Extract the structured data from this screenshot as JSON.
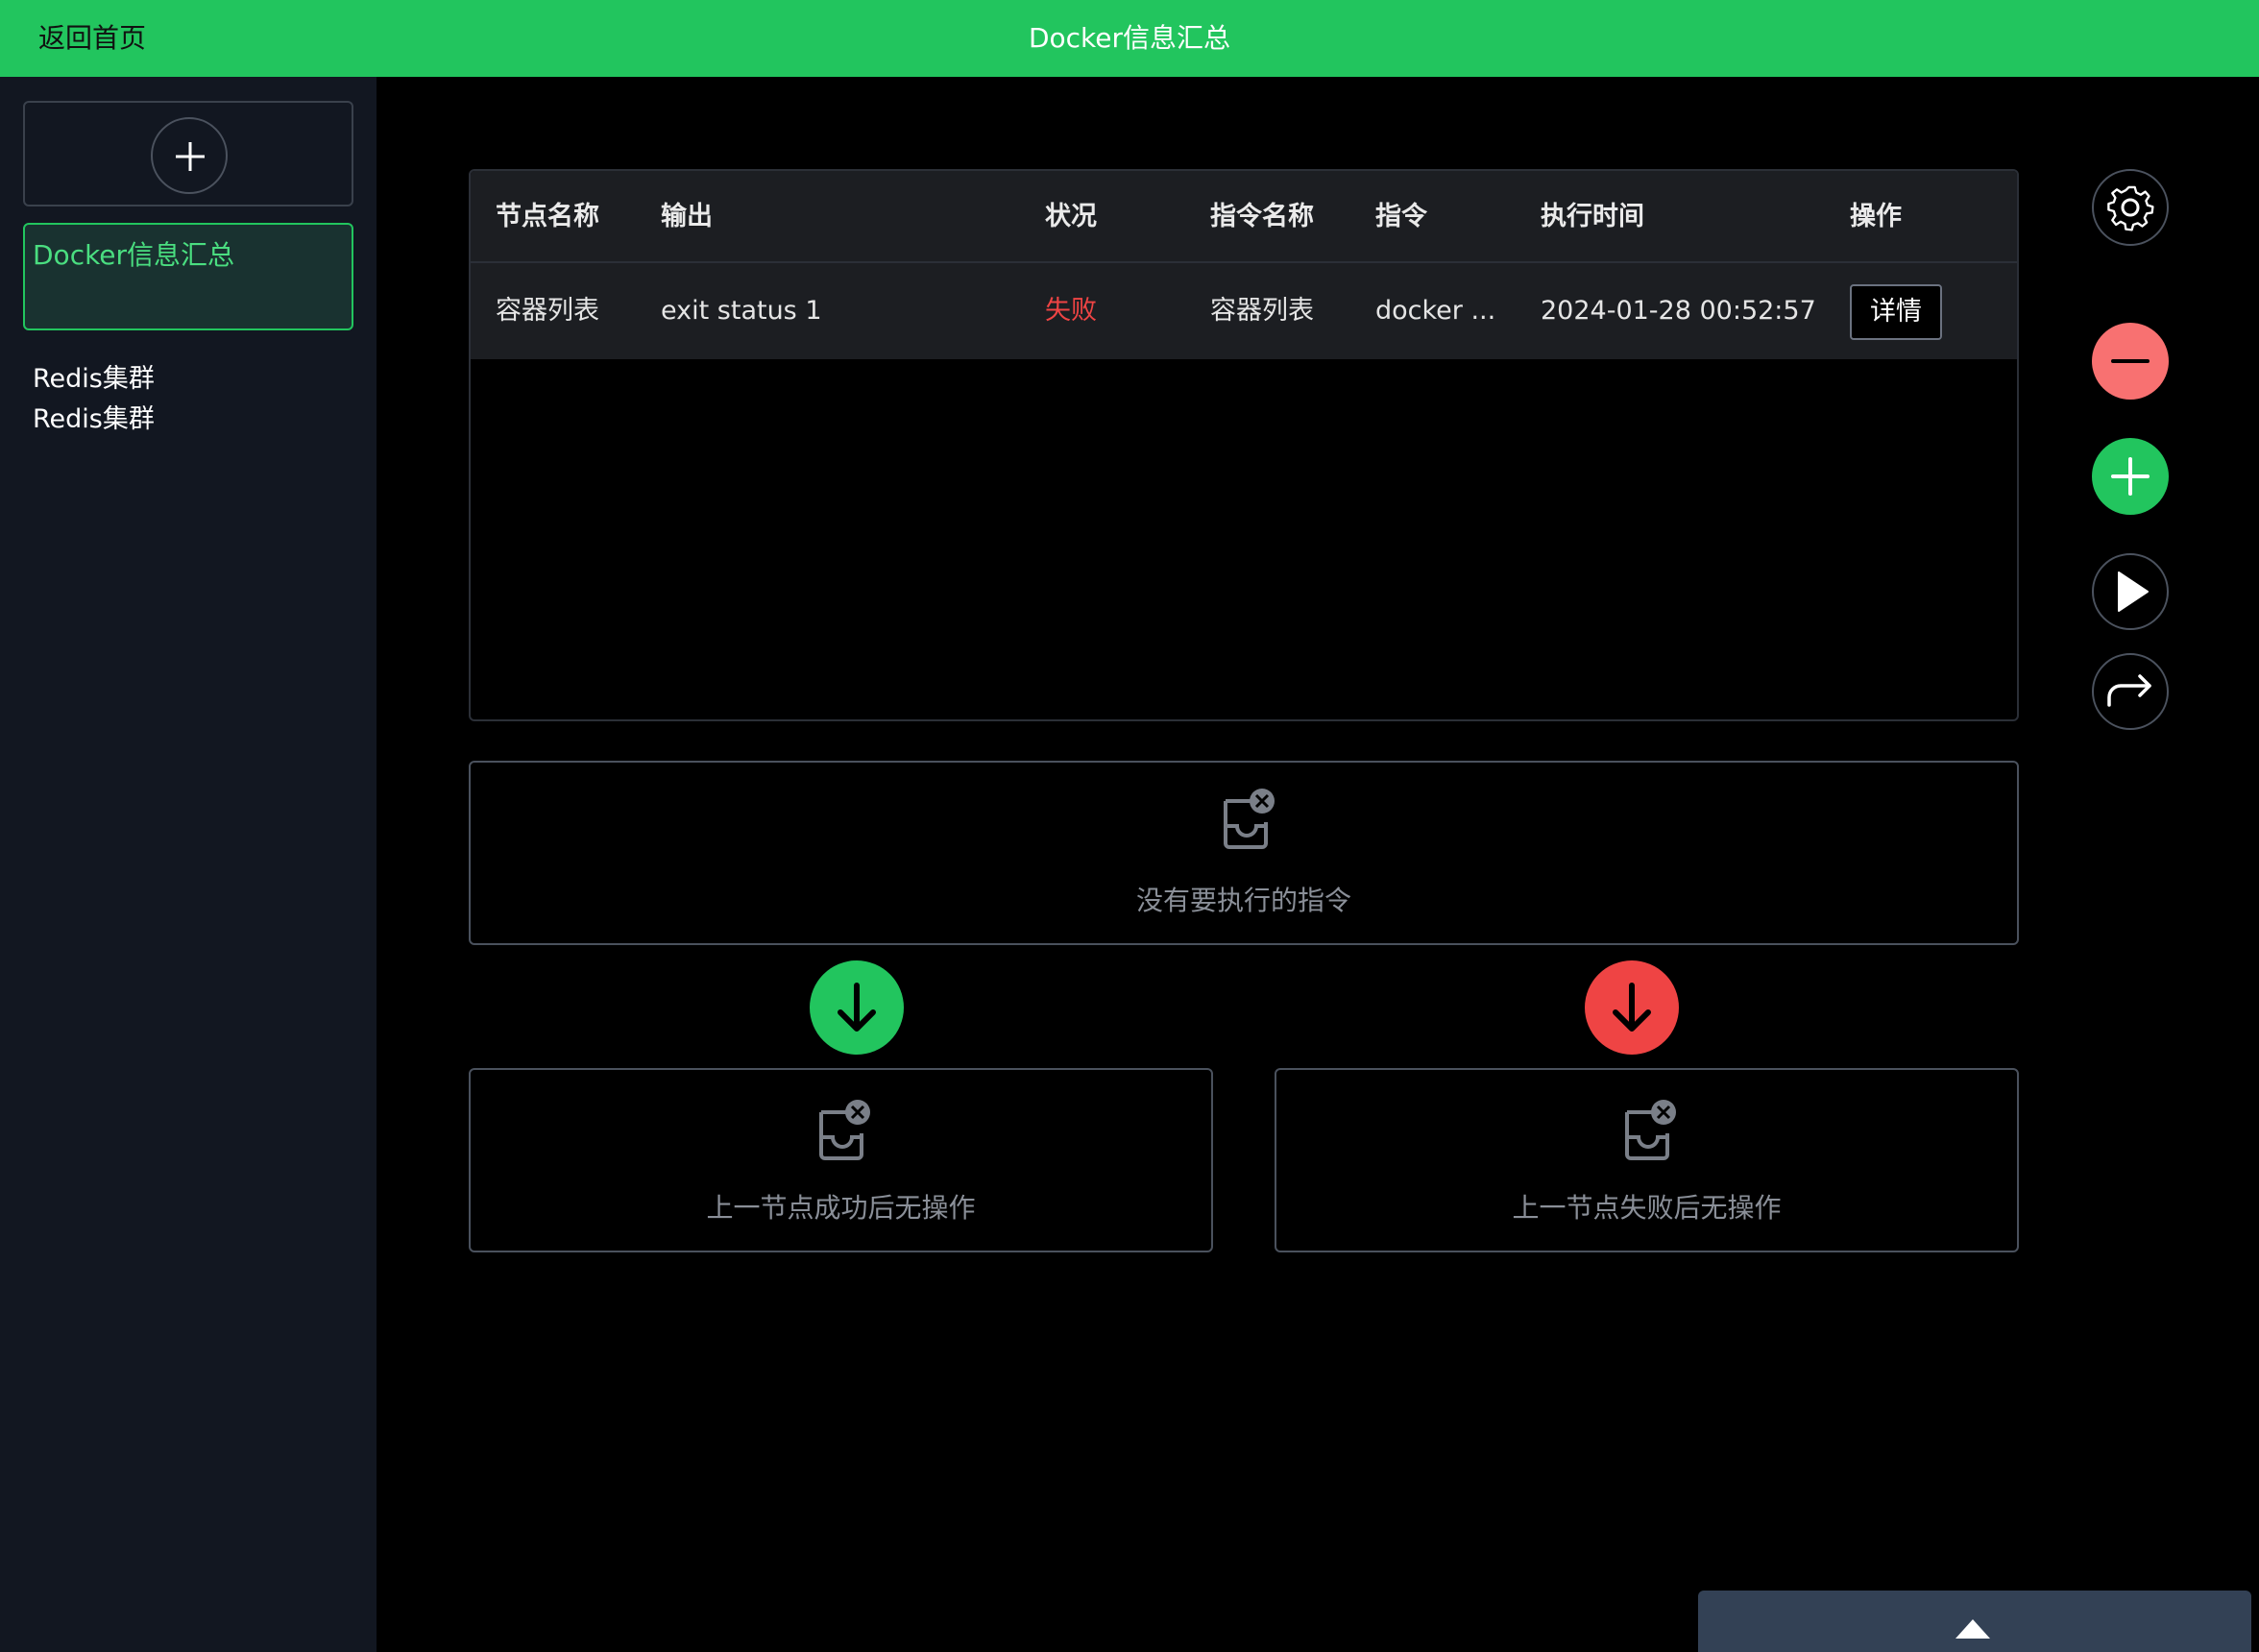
{
  "header": {
    "back_label": "返回首页",
    "title": "Docker信息汇总"
  },
  "sidebar": {
    "add_icon": "plus-icon",
    "active_item": "Docker信息汇总",
    "items": [
      "Redis集群",
      "Redis集群"
    ]
  },
  "table": {
    "columns": [
      "节点名称",
      "输出",
      "状况",
      "指令名称",
      "指令",
      "执行时间",
      "操作"
    ],
    "rows": [
      {
        "node_name": "容器列表",
        "output": "exit status 1",
        "status": "失败",
        "command_name": "容器列表",
        "command": "docker ...",
        "exec_time": "2024-01-28 00:52:57",
        "action_label": "详情"
      }
    ]
  },
  "empty_states": {
    "commands": "没有要执行的指令",
    "on_success": "上一节点成功后无操作",
    "on_failure": "上一节点失败后无操作"
  },
  "toolbar": {
    "icons": [
      "gear-icon",
      "minus-icon",
      "plus-icon",
      "play-icon",
      "redo-arrow-icon"
    ]
  },
  "drawer": {
    "icon": "caret-up-icon"
  },
  "colors": {
    "accent": "#22c55e",
    "danger": "#ef4444",
    "danger_soft": "#f87171",
    "sidebar_bg": "#121721",
    "drawer_bg": "#334155"
  }
}
